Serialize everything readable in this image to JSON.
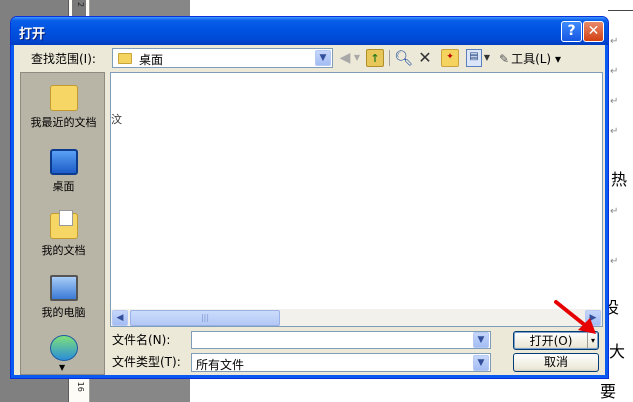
{
  "dialog": {
    "title": "打开",
    "help_symbol": "?",
    "close_symbol": "✕",
    "look_in": {
      "label": "查找范围(I):",
      "value": "桌面"
    },
    "toolbar": {
      "back_icon": "back-arrow-icon",
      "up_icon": "up-folder-icon",
      "search_icon": "search-web-icon",
      "delete_icon": "delete-icon",
      "new_folder_icon": "new-folder-icon",
      "views_icon": "views-menu-icon",
      "tools_label": "工具(L)"
    },
    "places": [
      {
        "label": "我最近的文档",
        "icon": "recent-documents-icon"
      },
      {
        "label": "桌面",
        "icon": "desktop-icon"
      },
      {
        "label": "我的文档",
        "icon": "my-documents-icon"
      },
      {
        "label": "我的电脑",
        "icon": "my-computer-icon"
      }
    ],
    "file_list": {
      "stray_char": "汶"
    },
    "file_name": {
      "label": "文件名(N):",
      "value": ""
    },
    "file_type": {
      "label": "文件类型(T):",
      "value": "所有文件"
    },
    "buttons": {
      "open": "打开(O)",
      "cancel": "取消"
    }
  },
  "document": {
    "ruler_numbers": [
      "2",
      "1 16"
    ],
    "visible_chars": [
      "热",
      "设",
      "大",
      "要"
    ]
  },
  "colors": {
    "title_blue": "#0054e3",
    "dialog_face": "#ece9d8",
    "arrow_red": "#e60000"
  }
}
